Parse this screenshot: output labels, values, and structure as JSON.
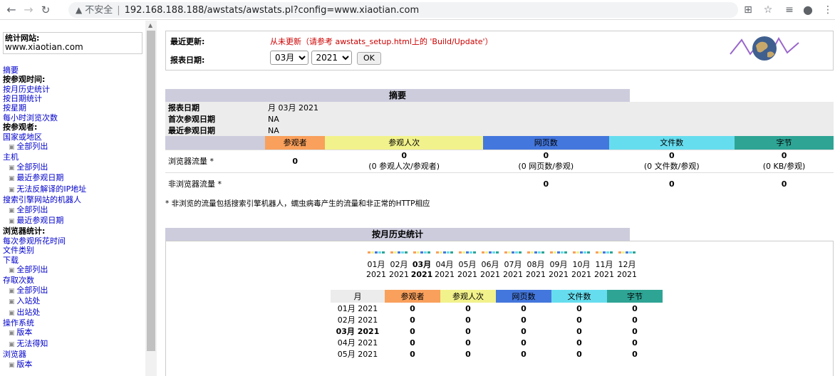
{
  "browser": {
    "security_label": "不安全",
    "url": "192.168.188.188/awstats/awstats.pl?config=www.xiaotian.com"
  },
  "menu": {
    "site_label": "统计网站:",
    "site_value": "www.xiaotian.com",
    "items": [
      {
        "text": "摘要",
        "type": "link"
      },
      {
        "text": "按参观时间:",
        "type": "header"
      },
      {
        "text": "按月历史统计",
        "type": "link"
      },
      {
        "text": "按日期统计",
        "type": "link"
      },
      {
        "text": "按星期",
        "type": "link"
      },
      {
        "text": "每小时浏览次数",
        "type": "link"
      },
      {
        "text": "按参观者:",
        "type": "header"
      },
      {
        "text": "国家或地区",
        "type": "link"
      },
      {
        "text": "全部列出",
        "type": "sub"
      },
      {
        "text": "主机",
        "type": "link"
      },
      {
        "text": "全部列出",
        "type": "sub"
      },
      {
        "text": "最近参观日期",
        "type": "sub"
      },
      {
        "text": "无法反解译的IP地址",
        "type": "sub"
      },
      {
        "text": "搜索引擎网站的机器人",
        "type": "link"
      },
      {
        "text": "全部列出",
        "type": "sub"
      },
      {
        "text": "最近参观日期",
        "type": "sub"
      },
      {
        "text": "浏览器统计:",
        "type": "header"
      },
      {
        "text": "每次参观所花时间",
        "type": "link"
      },
      {
        "text": "文件类别",
        "type": "link"
      },
      {
        "text": "下载",
        "type": "link"
      },
      {
        "text": "全部列出",
        "type": "sub"
      },
      {
        "text": "存取次数",
        "type": "link"
      },
      {
        "text": "全部列出",
        "type": "sub"
      },
      {
        "text": "入站处",
        "type": "sub"
      },
      {
        "text": "出站处",
        "type": "sub"
      },
      {
        "text": "操作系统",
        "type": "link"
      },
      {
        "text": "版本",
        "type": "sub"
      },
      {
        "text": "无法得知",
        "type": "sub"
      },
      {
        "text": "浏览器",
        "type": "link"
      },
      {
        "text": "版本",
        "type": "sub"
      }
    ]
  },
  "update": {
    "last_update_label": "最近更新:",
    "last_update_value": "从未更新（请参考 awstats_setup.html上的 'Build/Update'）",
    "report_date_label": "报表日期:",
    "month_selected": "03月",
    "year_selected": "2021",
    "ok_label": "OK"
  },
  "summary": {
    "title": "摘要",
    "rows": [
      {
        "key": "报表日期",
        "value": "月 03月 2021"
      },
      {
        "key": "首次参观日期",
        "value": "NA"
      },
      {
        "key": "最近参观日期",
        "value": "NA"
      }
    ],
    "columns": [
      "参观者",
      "参观人次",
      "网页数",
      "文件数",
      "字节"
    ],
    "browser_traffic": {
      "label": "浏览器流量 *",
      "values": [
        "0",
        "0",
        "0",
        "0",
        "0"
      ],
      "subs": [
        "",
        "(0 参观人次/参观者)",
        "(0 网页数/参观)",
        "(0 文件数/参观)",
        "(0 KB/参观)"
      ]
    },
    "non_browser_traffic": {
      "label": "非浏览器流量 *",
      "values": [
        "",
        "",
        "0",
        "0",
        "0"
      ]
    },
    "footnote": "* 非浏览的流量包括搜索引擎机器人，蠕虫病毒产生的流量和非正常的HTTP相应"
  },
  "monthly": {
    "title": "按月历史统计",
    "months": [
      "01月",
      "02月",
      "03月",
      "04月",
      "05月",
      "06月",
      "07月",
      "08月",
      "09月",
      "10月",
      "11月",
      "12月"
    ],
    "year": "2021",
    "current_index": 2,
    "table_header": [
      "月",
      "参观者",
      "参观人次",
      "网页数",
      "文件数",
      "字节"
    ],
    "rows": [
      {
        "month": "01月 2021",
        "values": [
          "0",
          "0",
          "0",
          "0",
          "0"
        ]
      },
      {
        "month": "02月 2021",
        "values": [
          "0",
          "0",
          "0",
          "0",
          "0"
        ]
      },
      {
        "month": "03月 2021",
        "values": [
          "0",
          "0",
          "0",
          "0",
          "0"
        ],
        "current": true
      },
      {
        "month": "04月 2021",
        "values": [
          "0",
          "0",
          "0",
          "0",
          "0"
        ]
      },
      {
        "month": "05月 2021",
        "values": [
          "0",
          "0",
          "0",
          "0",
          "0"
        ]
      }
    ]
  },
  "colors": {
    "visitors": "#f9a05c",
    "visits": "#f2f28c",
    "pages": "#4477dd",
    "hits": "#66ddee",
    "bytes": "#2ea495"
  }
}
